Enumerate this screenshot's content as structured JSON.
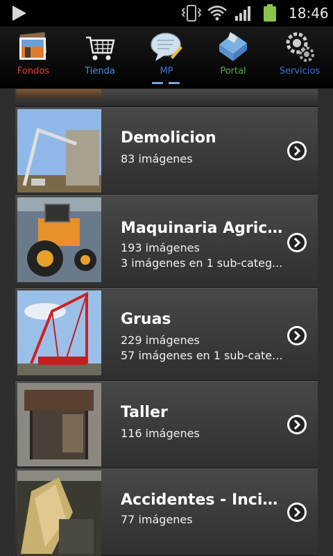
{
  "status_bar": {
    "time": "18:46",
    "icons": [
      "play-icon",
      "vibrate-icon",
      "wifi-icon",
      "signal-icon",
      "battery-icon"
    ],
    "battery_color": "#8bc34a"
  },
  "tabs": [
    {
      "label": "Fondos",
      "color": "#e04030",
      "icon": "photos-icon"
    },
    {
      "label": "Tienda",
      "color": "#4a8fd8",
      "icon": "cart-icon"
    },
    {
      "label": "MP",
      "color": "#3b6fd8",
      "icon": "speech-bubble-icon",
      "selected": true
    },
    {
      "label": "Portal",
      "color": "#4caf50",
      "icon": "globe-icon"
    },
    {
      "label": "Servicios",
      "color": "#3b6fd8",
      "icon": "gear-icon"
    }
  ],
  "categories": [
    {
      "title": "Demolicion",
      "line1": "83 imágenes",
      "line2": ""
    },
    {
      "title": "Maquinaria Agricola",
      "line1": "193 imágenes",
      "line2": "3 imágenes en 1 sub-categ..."
    },
    {
      "title": "Gruas",
      "line1": "229 imágenes",
      "line2": "57 imágenes en 1 sub-cate..."
    },
    {
      "title": "Taller",
      "line1": "116 imágenes",
      "line2": ""
    },
    {
      "title": "Accidentes - Incid...",
      "line1": "77 imágenes",
      "line2": ""
    }
  ]
}
